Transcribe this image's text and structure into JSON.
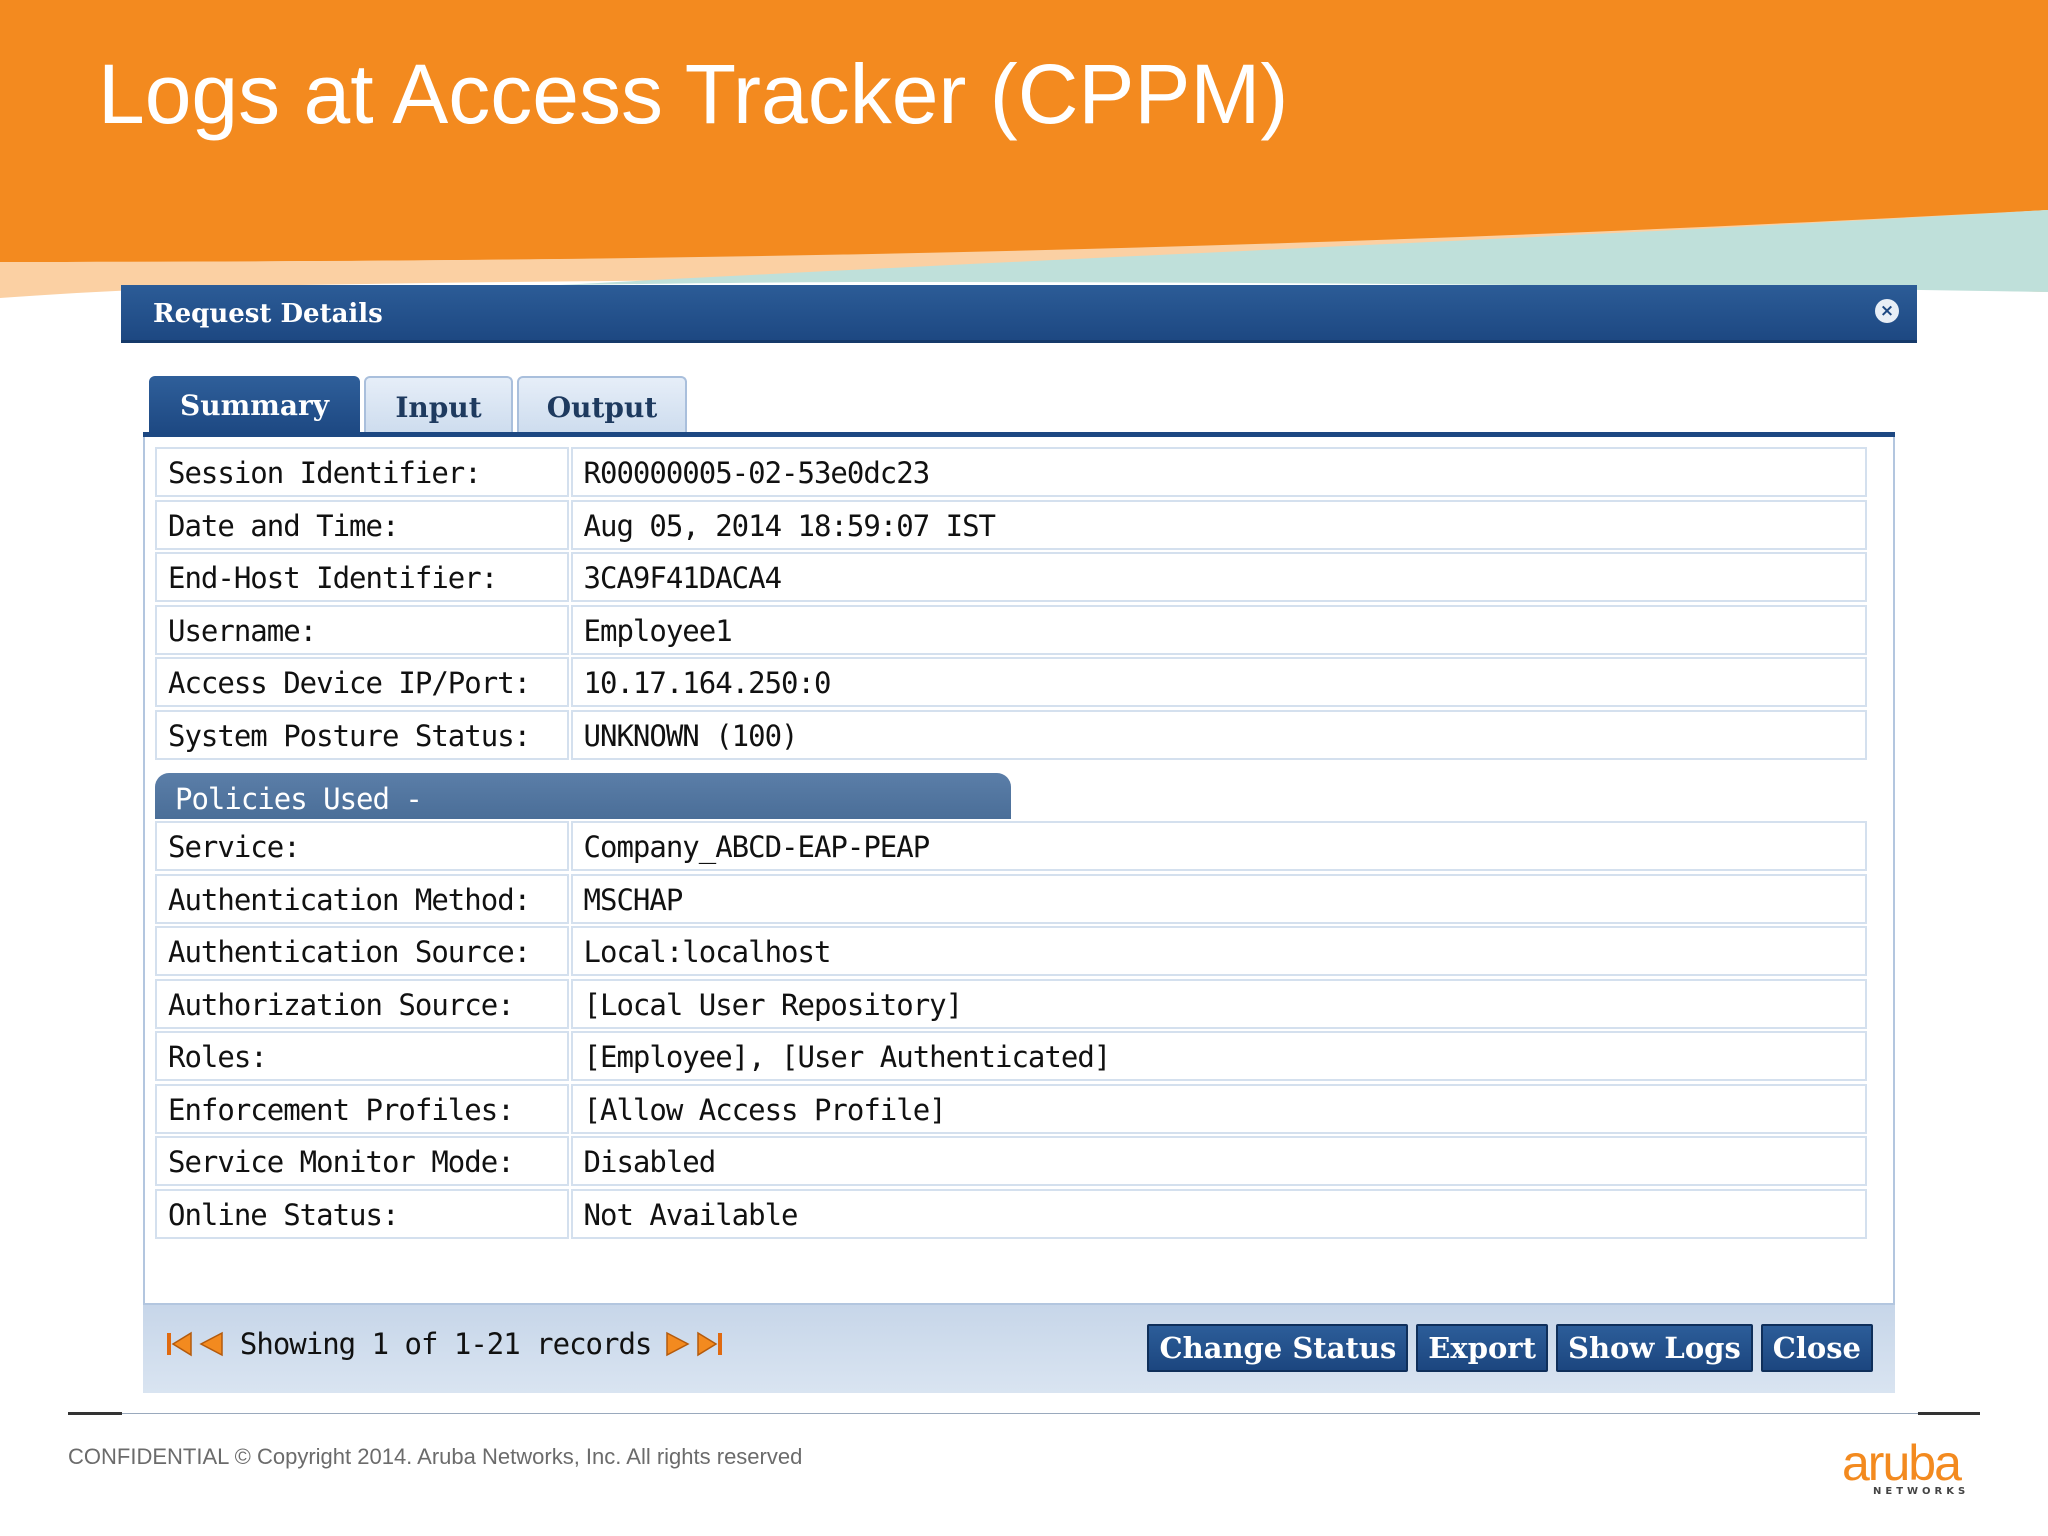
{
  "slide": {
    "title": "Logs at Access Tracker (CPPM)",
    "footer_text": "CONFIDENTIAL © Copyright 2014. Aruba Networks, Inc. All rights reserved",
    "logo_word": "aruba",
    "logo_sub": "NETWORKS",
    "colors": {
      "orange": "#f38a1f",
      "navy": "#1d4882",
      "teal": "#bfe0da"
    }
  },
  "dialog": {
    "title": "Request Details",
    "close_icon": "close-icon",
    "tabs": [
      {
        "label": "Summary",
        "active": true
      },
      {
        "label": "Input",
        "active": false
      },
      {
        "label": "Output",
        "active": false
      }
    ],
    "summary_rows": [
      {
        "label": "Session Identifier:",
        "value": "R00000005-02-53e0dc23"
      },
      {
        "label": "Date and Time:",
        "value": "Aug 05, 2014 18:59:07 IST"
      },
      {
        "label": "End-Host Identifier:",
        "value": "3CA9F41DACA4"
      },
      {
        "label": "Username:",
        "value": "Employee1"
      },
      {
        "label": "Access Device IP/Port:",
        "value": "10.17.164.250:0"
      },
      {
        "label": "System Posture Status:",
        "value": "UNKNOWN (100)"
      }
    ],
    "policies_heading": "Policies Used -",
    "policy_rows": [
      {
        "label": "Service:",
        "value": "Company_ABCD-EAP-PEAP"
      },
      {
        "label": "Authentication Method:",
        "value": "MSCHAP"
      },
      {
        "label": "Authentication Source:",
        "value": "Local:localhost"
      },
      {
        "label": "Authorization Source:",
        "value": "[Local User Repository]"
      },
      {
        "label": "Roles:",
        "value": "[Employee], [User Authenticated]"
      },
      {
        "label": "Enforcement Profiles:",
        "value": "[Allow Access Profile]"
      },
      {
        "label": "Service Monitor Mode:",
        "value": "Disabled"
      },
      {
        "label": "Online Status:",
        "value": "Not Available"
      }
    ],
    "pager": {
      "text": "Showing 1 of 1-21 records",
      "icons": [
        "first-page-icon",
        "prev-page-icon",
        "next-page-icon",
        "last-page-icon"
      ]
    },
    "buttons": {
      "change_status": "Change Status",
      "export": "Export",
      "show_logs": "Show Logs",
      "close": "Close"
    }
  }
}
